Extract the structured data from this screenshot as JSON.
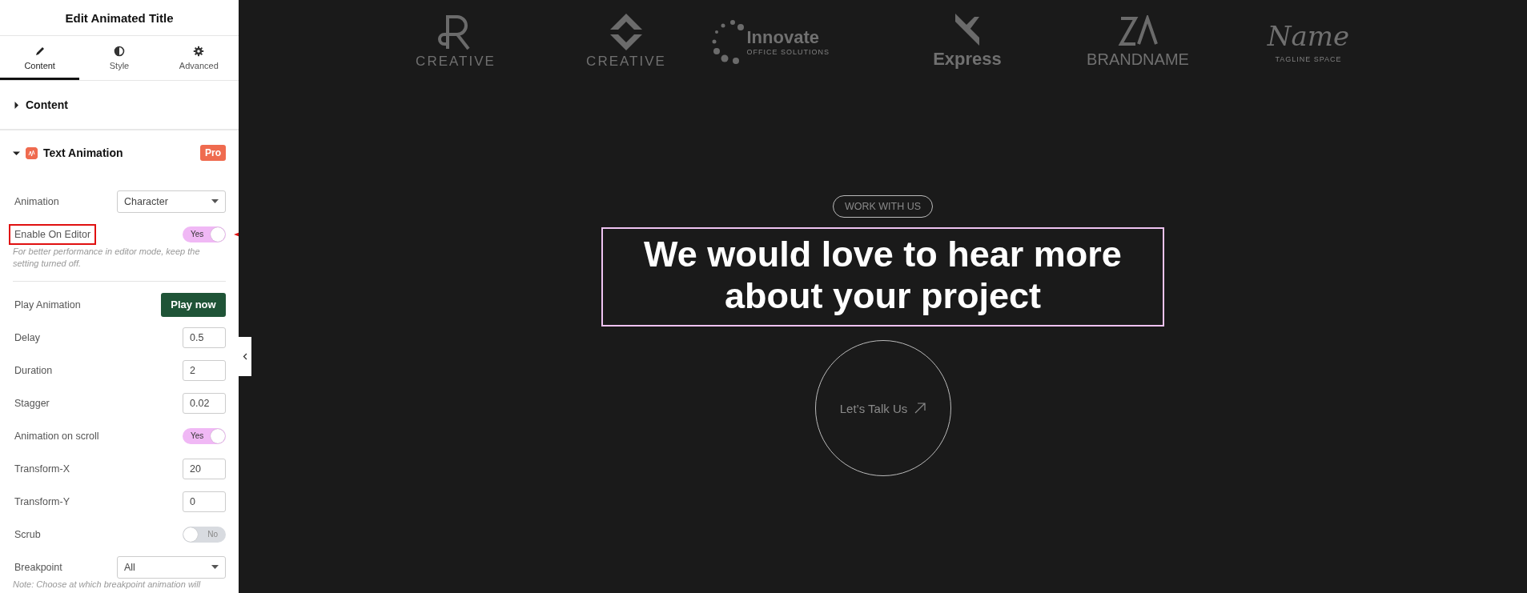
{
  "panel": {
    "title": "Edit Animated Title",
    "tabs": [
      {
        "label": "Content",
        "selected": true
      },
      {
        "label": "Style",
        "selected": false
      },
      {
        "label": "Advanced",
        "selected": false
      }
    ],
    "sections": [
      {
        "title": "Content",
        "expanded": false
      },
      {
        "title": "Text Animation",
        "expanded": true,
        "badge": "Pro",
        "fields": [
          {
            "kind": "select",
            "label": "Animation",
            "value": "Character",
            "highlighted": false
          },
          {
            "kind": "toggle",
            "label": "Enable On Editor",
            "on": true,
            "text": "Yes",
            "highlighted": true
          },
          {
            "kind": "note",
            "text": "For better performance in editor mode, keep the setting turned off."
          },
          {
            "kind": "divider"
          },
          {
            "kind": "button",
            "label": "Play Animation",
            "text": "Play now",
            "highlighted": false
          },
          {
            "kind": "number",
            "label": "Delay",
            "value": "0.5",
            "highlighted": false
          },
          {
            "kind": "number",
            "label": "Duration",
            "value": "2",
            "highlighted": false
          },
          {
            "kind": "number",
            "label": "Stagger",
            "value": "0.02",
            "highlighted": false
          },
          {
            "kind": "toggle",
            "label": "Animation on scroll",
            "on": true,
            "text": "Yes",
            "highlighted": false
          },
          {
            "kind": "number",
            "label": "Transform-X",
            "value": "20",
            "highlighted": false
          },
          {
            "kind": "number",
            "label": "Transform-Y",
            "value": "0",
            "highlighted": false
          },
          {
            "kind": "toggle",
            "label": "Scrub",
            "on": false,
            "text": "No",
            "highlighted": false
          },
          {
            "kind": "select",
            "label": "Breakpoint",
            "value": "All",
            "highlighted": false
          },
          {
            "kind": "note",
            "text": "Note: Choose at which breakpoint animation will"
          }
        ]
      }
    ]
  },
  "canvas": {
    "logos": [
      {
        "name": "CREATIVE"
      },
      {
        "name": "CREATIVE"
      },
      {
        "name": "Innovate",
        "tagline": "OFFICE SOLUTIONS"
      },
      {
        "name": "Express"
      },
      {
        "name": "BRANDNAME"
      },
      {
        "name": "Name",
        "tagline": "TAGLINE SPACE"
      }
    ],
    "badge": "WORK WITH US",
    "headline": {
      "text": "We would love to hear more about your project",
      "selected": true
    },
    "cta": "Let’s Talk Us"
  }
}
